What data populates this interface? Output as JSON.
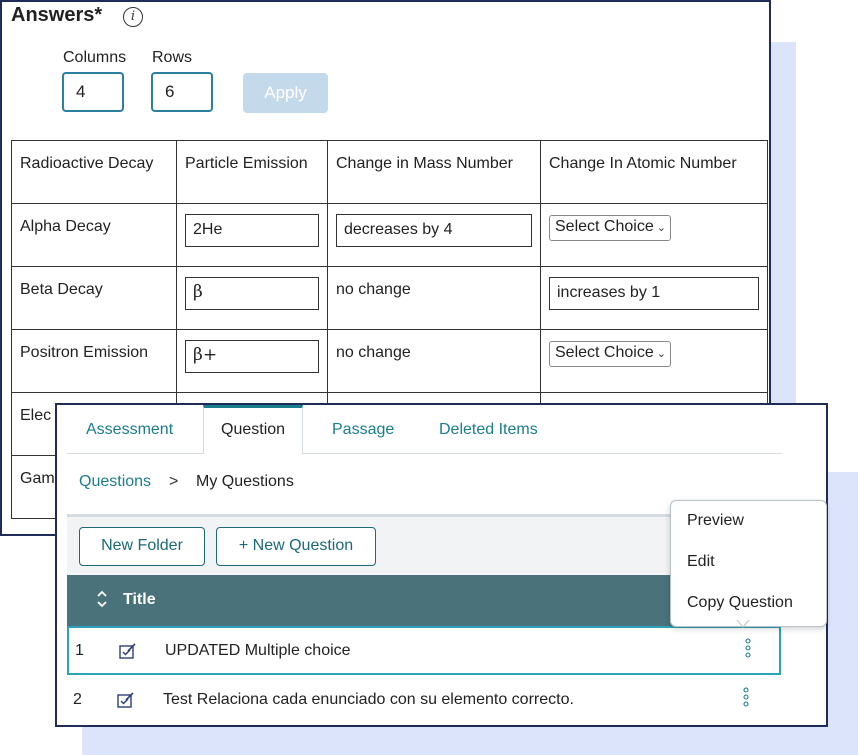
{
  "answers": {
    "title": "Answers*",
    "info_icon": "info-icon",
    "columns_label": "Columns",
    "rows_label": "Rows",
    "columns_value": "4",
    "rows_value": "6",
    "apply_label": "Apply",
    "headers": [
      "Radioactive Decay",
      "Particle Emission",
      "Change in Mass Number",
      "Change In Atomic Number"
    ],
    "rows": [
      {
        "decay": "Alpha Decay",
        "particle": "2He",
        "mass": "decreases by 4",
        "atomic": "Select Choice"
      },
      {
        "decay": "Beta Decay",
        "particle": "β",
        "mass": "no change",
        "atomic": "increases by 1"
      },
      {
        "decay": "Positron Emission",
        "particle": "β+",
        "mass": "no change",
        "atomic": "Select Choice"
      },
      {
        "decay": "Elec"
      },
      {
        "decay": "Gam"
      }
    ]
  },
  "bank": {
    "tabs": [
      "Assessment",
      "Question",
      "Passage",
      "Deleted Items"
    ],
    "active_tab": "Question",
    "breadcrumb": {
      "root": "Questions",
      "separator": ">",
      "current": "My Questions"
    },
    "new_folder_label": "New Folder",
    "new_question_label": "+ New Question",
    "column_title": "Title",
    "items": [
      {
        "num": "1",
        "title": "UPDATED Multiple choice",
        "icon": "edit-question-icon"
      },
      {
        "num": "2",
        "title": "Test Relaciona cada enunciado con su elemento correcto.",
        "icon": "edit-question-icon"
      }
    ],
    "menu": [
      "Preview",
      "Edit",
      "Copy Question"
    ]
  },
  "colors": {
    "accent": "#1a7d8c",
    "header_bg": "#4a727b",
    "card_border": "#1f2c5a",
    "backdrop": "#dbe4fb",
    "apply_disabled": "#c4daea"
  }
}
